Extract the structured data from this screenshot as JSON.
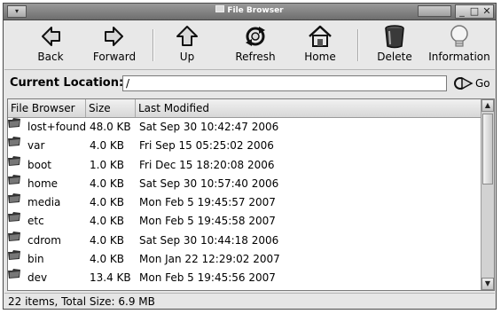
{
  "window": {
    "title": "File Browser",
    "menu_glyph": "▾",
    "controls": [
      "_",
      "□",
      "✕"
    ]
  },
  "toolbar": {
    "buttons": [
      {
        "id": "back",
        "label": "Back",
        "icon": "back-arrow-icon"
      },
      {
        "id": "forward",
        "label": "Forward",
        "icon": "forward-arrow-icon"
      },
      {
        "id": "up",
        "label": "Up",
        "icon": "up-arrow-icon"
      },
      {
        "id": "refresh",
        "label": "Refresh",
        "icon": "refresh-icon"
      },
      {
        "id": "home",
        "label": "Home",
        "icon": "home-icon"
      },
      {
        "id": "delete",
        "label": "Delete",
        "icon": "trash-icon"
      },
      {
        "id": "information",
        "label": "Information",
        "icon": "lightbulb-icon"
      }
    ]
  },
  "location": {
    "label": "Current Location:",
    "value": "/",
    "go_label": "Go"
  },
  "list": {
    "columns": [
      "File Browser",
      "Size",
      "Last Modified"
    ],
    "rows": [
      {
        "name": "lost+found",
        "size": "48.0 KB",
        "modified": "Sat Sep 30 10:42:47 2006"
      },
      {
        "name": "var",
        "size": "4.0 KB",
        "modified": "Fri Sep 15 05:25:02 2006"
      },
      {
        "name": "boot",
        "size": "1.0 KB",
        "modified": "Fri Dec 15 18:20:08 2006"
      },
      {
        "name": "home",
        "size": "4.0 KB",
        "modified": "Sat Sep 30 10:57:40 2006"
      },
      {
        "name": "media",
        "size": "4.0 KB",
        "modified": "Mon Feb  5 19:45:57 2007"
      },
      {
        "name": "etc",
        "size": "4.0 KB",
        "modified": "Mon Feb  5 19:45:58 2007"
      },
      {
        "name": "cdrom",
        "size": "4.0 KB",
        "modified": "Sat Sep 30 10:44:18 2006"
      },
      {
        "name": "bin",
        "size": "4.0 KB",
        "modified": "Mon Jan 22 12:29:02 2007"
      },
      {
        "name": "dev",
        "size": "13.4 KB",
        "modified": "Mon Feb  5 19:45:56 2007"
      }
    ]
  },
  "status": {
    "text": "22 items, Total Size: 6.9 MB"
  },
  "colors": {
    "titlebar": "#7f7f7f",
    "window_bg": "#e6e6e6",
    "list_bg": "#ffffff"
  }
}
